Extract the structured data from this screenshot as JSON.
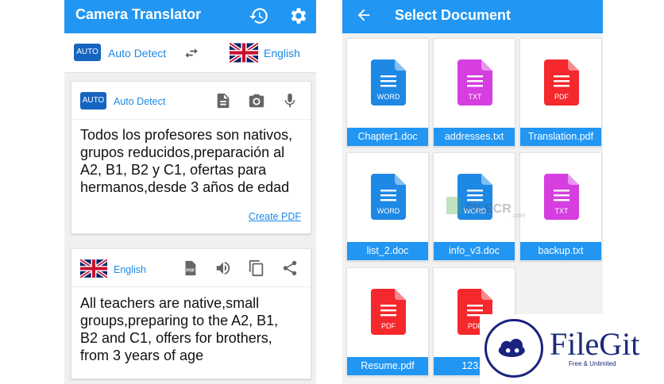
{
  "left_screen": {
    "app_title": "Camera Translator",
    "language_bar": {
      "source_badge": "AUTO",
      "source_language": "Auto Detect",
      "target_language": "English"
    },
    "source_card": {
      "badge": "AUTO",
      "language": "Auto Detect",
      "text": "Todos los profesores son nativos,\ngrupos reducidos,preparación al\nA2, B1, B2 y C1, ofertas para\nhermanos,desde 3 años de edad",
      "create_pdf_link": "Create PDF"
    },
    "target_card": {
      "language": "English",
      "pdf_badge": "PDF",
      "text": "All teachers are native,small\ngroups,preparing to the A2, B1,\nB2 and C1, offers for brothers,\nfrom 3 years of age"
    },
    "icons": [
      "history-icon",
      "settings-icon",
      "swap-icon",
      "document-icon",
      "camera-icon",
      "microphone-icon",
      "pdf-icon",
      "speaker-icon",
      "copy-icon",
      "share-icon"
    ]
  },
  "right_screen": {
    "title": "Select Document",
    "files": [
      {
        "name": "Chapter1.doc",
        "type": "WORD",
        "color": "#1e88e5"
      },
      {
        "name": "addresses.txt",
        "type": "TXT",
        "color": "#d63ee0"
      },
      {
        "name": "Translation.pdf",
        "type": "PDF",
        "color": "#f4282d"
      },
      {
        "name": "list_2.doc",
        "type": "WORD",
        "color": "#1e88e5"
      },
      {
        "name": "info_v3.doc",
        "type": "WORD",
        "color": "#1e88e5"
      },
      {
        "name": "backup.txt",
        "type": "TXT",
        "color": "#d63ee0"
      },
      {
        "name": "Resume.pdf",
        "type": "PDF",
        "color": "#f4282d"
      },
      {
        "name": "123.p",
        "type": "PDF",
        "color": "#f4282d"
      }
    ]
  },
  "watermarks": {
    "fileecr": "FILECR",
    "fileecr_domain": ".com",
    "filegit_name": "FileGit",
    "filegit_tagline": "Free & Unlimited"
  },
  "colors": {
    "primary": "#2196f3",
    "badge": "#1565c0",
    "link": "#1e88e5"
  }
}
